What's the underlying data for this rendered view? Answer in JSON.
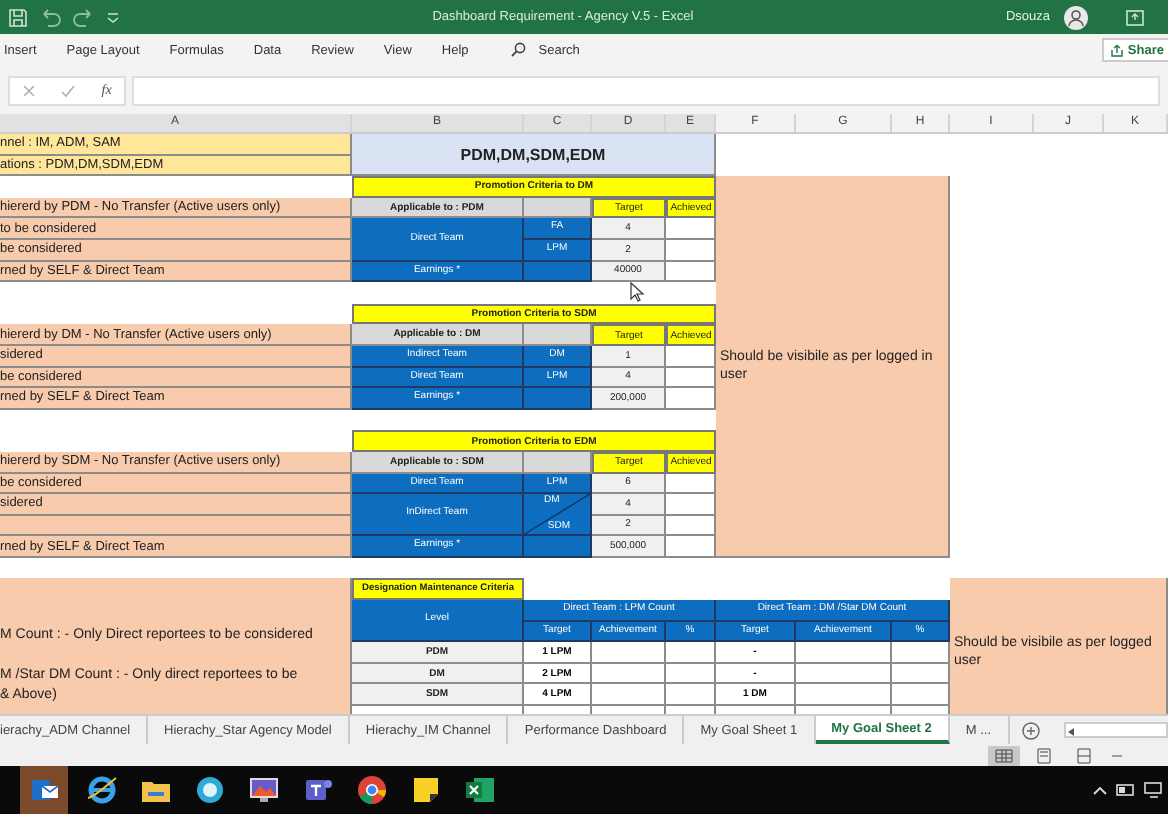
{
  "window": {
    "title": "Dashboard Requirement - Agency  V.5  -  Excel",
    "user": "Dsouza"
  },
  "ribbon_tabs": [
    "Insert",
    "Page Layout",
    "Formulas",
    "Data",
    "Review",
    "View",
    "Help"
  ],
  "search": {
    "placeholder": "Search"
  },
  "share": "Share",
  "formula_bar": {
    "function_label": "fx"
  },
  "column_headers": [
    "A",
    "B",
    "C",
    "D",
    "E",
    "F",
    "G",
    "H",
    "I",
    "J",
    "K"
  ],
  "left_notes": [
    {
      "kind": "header",
      "text": "nnel : IM, ADM, SAM"
    },
    {
      "kind": "header",
      "text": "ations :  PDM,DM,SDM,EDM"
    },
    {
      "kind": "blank"
    },
    {
      "kind": "criteria",
      "text": "hiererd by PDM - No Transfer (Active users only)"
    },
    {
      "kind": "criteria",
      "text": "to be considered"
    },
    {
      "kind": "criteria",
      "text": "be considered"
    },
    {
      "kind": "criteria",
      "text": "rned by SELF & Direct Team"
    },
    {
      "kind": "blank"
    },
    {
      "kind": "blank"
    },
    {
      "kind": "criteria",
      "text": "hiererd by DM - No Transfer (Active users only)"
    },
    {
      "kind": "criteria",
      "text": "sidered"
    },
    {
      "kind": "criteria",
      "text": "be considered"
    },
    {
      "kind": "criteria",
      "text": "rned by SELF & Direct Team"
    },
    {
      "kind": "blank"
    },
    {
      "kind": "blank"
    },
    {
      "kind": "criteria",
      "text": "hiererd by SDM - No Transfer (Active users only)"
    },
    {
      "kind": "criteria",
      "text": "be considered"
    },
    {
      "kind": "criteria",
      "text": "sidered"
    },
    {
      "kind": "criteria"
    },
    {
      "kind": "criteria",
      "text": "rned by SELF & Direct Team"
    },
    {
      "kind": "blank"
    }
  ],
  "banner": "PDM,DM,SDM,EDM",
  "promotion_tables": [
    {
      "title": "Promotion Criteria to DM",
      "applicable": "Applicable to : PDM",
      "target_label": "Target",
      "achieved_label": "Achieved",
      "groups": [
        {
          "label": "Direct Team",
          "kind": "plain",
          "subs": [
            {
              "label": "FA",
              "target": "4"
            },
            {
              "label": "LPM",
              "target": "2"
            }
          ]
        },
        {
          "label": "Earnings *",
          "kind": "plain",
          "subs": [
            {
              "target": "40000"
            }
          ]
        }
      ]
    },
    {
      "title": "Promotion Criteria to SDM",
      "applicable": "Applicable to : DM",
      "target_label": "Target",
      "achieved_label": "Achieved",
      "groups": [
        {
          "label": "Indirect Team",
          "kind": "plain",
          "subs": [
            {
              "label": "DM",
              "target": "1"
            }
          ]
        },
        {
          "label": "Direct Team",
          "kind": "plain",
          "subs": [
            {
              "label": "LPM",
              "target": "4"
            }
          ]
        },
        {
          "label": "Earnings *",
          "kind": "plain",
          "subs": [
            {
              "target": "200,000"
            }
          ]
        }
      ]
    },
    {
      "title": "Promotion Criteria to EDM",
      "applicable": "Applicable to : SDM",
      "target_label": "Target",
      "achieved_label": "Achieved",
      "groups": [
        {
          "label": "Direct Team",
          "kind": "plain",
          "subs": [
            {
              "label": "LPM",
              "target": "6"
            }
          ]
        },
        {
          "label": "InDirect Team",
          "kind": "split",
          "subs": [
            {
              "label": "DM",
              "target": "4"
            },
            {
              "label": "SDM",
              "target": "2"
            }
          ]
        },
        {
          "label": "Earnings *",
          "kind": "plain",
          "subs": [
            {
              "target": "500,000"
            }
          ]
        }
      ]
    }
  ],
  "promotion_note": "Should be visibile as per logged in user",
  "designation": {
    "title": "Designation Maintenance Criteria",
    "level_header": "Level",
    "group_headers": [
      "Direct Team : LPM Count",
      "Direct Team : DM /Star DM Count"
    ],
    "sub_headers": [
      "Target",
      "Achievement",
      "%",
      "Target",
      "Achievement",
      "%"
    ],
    "rows": [
      {
        "level": "PDM",
        "lpm_target": "1 LPM",
        "dm_target": "-"
      },
      {
        "level": "DM",
        "lpm_target": "2 LPM",
        "dm_target": "-"
      },
      {
        "level": "SDM",
        "lpm_target": "4 LPM",
        "dm_target": "1 DM"
      }
    ],
    "left_notes": [
      "M Count  : - Only Direct reportees to be considered",
      "M /Star DM Count : - Only direct reportees to be\n& Above)"
    ],
    "note": "Should be visibile as per logged user"
  },
  "sheet_tabs": [
    {
      "label": "ierachy_ADM Channel",
      "selected": false
    },
    {
      "label": "Hierachy_Star Agency Model",
      "selected": false
    },
    {
      "label": "Hierachy_IM Channel",
      "selected": false
    },
    {
      "label": "Performance Dashboard",
      "selected": false
    },
    {
      "label": "My Goal Sheet 1",
      "selected": false
    },
    {
      "label": "My Goal Sheet 2",
      "selected": true
    },
    {
      "label": "M ...",
      "selected": false
    }
  ]
}
